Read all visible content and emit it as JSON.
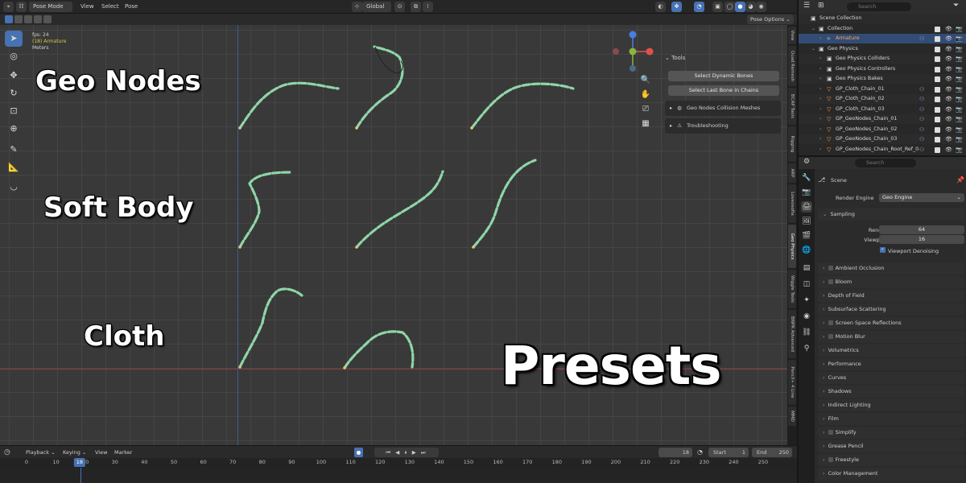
{
  "header": {
    "mode": "Pose Mode",
    "menus": [
      "View",
      "Select",
      "Pose"
    ],
    "orientation": "Global",
    "pose_options": "Pose Options"
  },
  "viewport": {
    "info": [
      "fps: 24",
      "(18) Armature",
      "Meters"
    ],
    "labels": {
      "geo_nodes": "Geo Nodes",
      "soft_body": "Soft Body",
      "cloth": "Cloth",
      "presets": "Presets"
    }
  },
  "npanel": {
    "title": "Tools",
    "buttons": [
      "Select Dynamic Bones",
      "Select Last Bone in Chains"
    ],
    "subpanels": [
      "Geo Nodes Collision Meshes",
      "Troubleshooting"
    ]
  },
  "side_tabs": [
    "View",
    "Quad Remesh",
    "BCAP Tools",
    "Rigging",
    "ARP",
    "Loveosofia",
    "Geo Physics",
    "Wiggle Tools",
    "BNPR Advanced",
    "Pencil+ 4 Line",
    "MMD"
  ],
  "timeline": {
    "menus": [
      "Playback",
      "Keying",
      "View",
      "Marker"
    ],
    "current_frame": "18",
    "start_label": "Start",
    "start": "1",
    "end_label": "End",
    "end": "250",
    "ticks": [
      "0",
      "10",
      "20",
      "30",
      "40",
      "50",
      "60",
      "70",
      "80",
      "90",
      "100",
      "110",
      "120",
      "130",
      "140",
      "150",
      "160",
      "170",
      "180",
      "190",
      "200",
      "210",
      "220",
      "230",
      "240",
      "250"
    ]
  },
  "outliner": {
    "search_placeholder": "Search",
    "rows": [
      {
        "name": "Scene Collection",
        "indent": 0,
        "icon": "collection-icon"
      },
      {
        "name": "Collection",
        "indent": 1,
        "icon": "collection-icon"
      },
      {
        "name": "Armature",
        "indent": 2,
        "icon": "armature-icon",
        "selected": true
      },
      {
        "name": "Geo Physics",
        "indent": 1,
        "icon": "collection-icon"
      },
      {
        "name": "Geo Physics Colliders",
        "indent": 2,
        "icon": "collection-icon"
      },
      {
        "name": "Geo Physics Controllers",
        "indent": 2,
        "icon": "collection-icon"
      },
      {
        "name": "Geo Physics Bakes",
        "indent": 2,
        "icon": "collection-icon"
      },
      {
        "name": "GP_Cloth_Chain_01",
        "indent": 2,
        "icon": "mesh-icon"
      },
      {
        "name": "GP_Cloth_Chain_02",
        "indent": 2,
        "icon": "mesh-icon"
      },
      {
        "name": "GP_Cloth_Chain_03",
        "indent": 2,
        "icon": "mesh-icon"
      },
      {
        "name": "GP_GeoNodes_Chain_01",
        "indent": 2,
        "icon": "mesh-icon"
      },
      {
        "name": "GP_GeoNodes_Chain_02",
        "indent": 2,
        "icon": "mesh-icon"
      },
      {
        "name": "GP_GeoNodes_Chain_03",
        "indent": 2,
        "icon": "mesh-icon"
      },
      {
        "name": "GP_GeoNodes_Chain_Root_Ref_0",
        "indent": 2,
        "icon": "mesh-icon"
      }
    ]
  },
  "properties": {
    "search_placeholder": "Search",
    "scene_label": "Scene",
    "render_engine_label": "Render Engine",
    "render_engine": "Geo Engine",
    "sampling": {
      "title": "Sampling",
      "render_label": "Render",
      "render": "64",
      "viewport_label": "Viewport",
      "viewport": "16",
      "denoise_label": "Viewport Denoising"
    },
    "sections": [
      {
        "name": "Ambient Occlusion",
        "check": true
      },
      {
        "name": "Bloom",
        "check": true
      },
      {
        "name": "Depth of Field",
        "check": false
      },
      {
        "name": "Subsurface Scattering",
        "check": false
      },
      {
        "name": "Screen Space Reflections",
        "check": true
      },
      {
        "name": "Motion Blur",
        "check": true
      },
      {
        "name": "Volumetrics",
        "check": false
      },
      {
        "name": "Performance",
        "check": false
      },
      {
        "name": "Curves",
        "check": false
      },
      {
        "name": "Shadows",
        "check": false
      },
      {
        "name": "Indirect Lighting",
        "check": false
      },
      {
        "name": "Film",
        "check": false
      },
      {
        "name": "Simplify",
        "check": true
      },
      {
        "name": "Grease Pencil",
        "check": false
      },
      {
        "name": "Freestyle",
        "check": true
      },
      {
        "name": "Color Management",
        "check": false
      }
    ]
  },
  "colors": {
    "accent": "#4772b3",
    "bone": "#8fd5a9",
    "selected_text": "#ffa84a",
    "info_yellow": "#d9c845"
  }
}
